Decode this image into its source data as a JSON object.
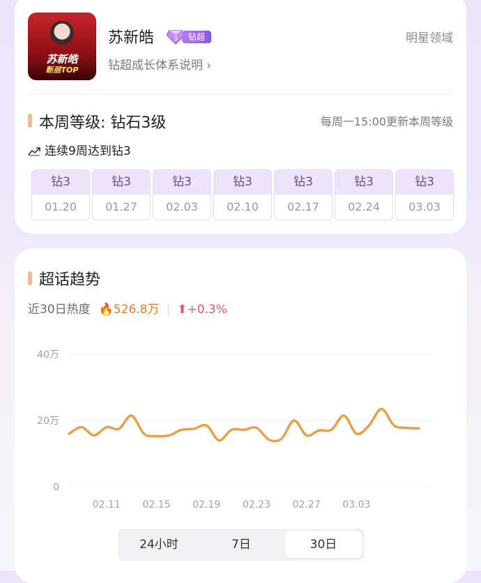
{
  "profile": {
    "avatar_text_1": "苏新皓",
    "avatar_text_2": "断层TOP",
    "name": "苏新皓",
    "badge_level": "3",
    "badge_label": "钻超",
    "growth_link": "钻超成长体系说明 ›",
    "region": "明星领域"
  },
  "level": {
    "title": "本周等级: 钻石3级",
    "update_note": "每周一15:00更新本周等级",
    "streak": "连续9周达到钻3",
    "weeks": [
      {
        "level": "钻3",
        "date": "01.20"
      },
      {
        "level": "钻3",
        "date": "01.27"
      },
      {
        "level": "钻3",
        "date": "02.03"
      },
      {
        "level": "钻3",
        "date": "02.10"
      },
      {
        "level": "钻3",
        "date": "02.17"
      },
      {
        "level": "钻3",
        "date": "02.24"
      },
      {
        "level": "钻3",
        "date": "03.03"
      }
    ]
  },
  "trend": {
    "title": "超话趋势",
    "heat_label": "近30日热度",
    "heat_value": "526.8万",
    "change": "+0.3%",
    "icons": {
      "fire": "fire-icon",
      "up": "arrow-up-icon"
    },
    "colors": {
      "line": "#e8a04a",
      "accent": "#f2b98a",
      "up": "#e8536b"
    }
  },
  "chart_data": {
    "type": "line",
    "y_ticks": [
      "0",
      "20万",
      "40万"
    ],
    "ylim": [
      0,
      400000
    ],
    "x_tick_labels": [
      "02.11",
      "02.15",
      "02.19",
      "02.23",
      "02.27",
      "03.03"
    ],
    "x_range": [
      "02.08",
      "03.09"
    ],
    "grid": true,
    "series": [
      {
        "values": [
          {
            "x": "02.08",
            "y": 160000
          },
          {
            "x": "02.09",
            "y": 180000
          },
          {
            "x": "02.10",
            "y": 155000
          },
          {
            "x": "02.11",
            "y": 180000
          },
          {
            "x": "02.12",
            "y": 175000
          },
          {
            "x": "02.13",
            "y": 215000
          },
          {
            "x": "02.14",
            "y": 160000
          },
          {
            "x": "02.15",
            "y": 153000
          },
          {
            "x": "02.16",
            "y": 155000
          },
          {
            "x": "02.17",
            "y": 172000
          },
          {
            "x": "02.18",
            "y": 175000
          },
          {
            "x": "02.19",
            "y": 185000
          },
          {
            "x": "02.20",
            "y": 140000
          },
          {
            "x": "02.21",
            "y": 172000
          },
          {
            "x": "02.22",
            "y": 172000
          },
          {
            "x": "02.23",
            "y": 178000
          },
          {
            "x": "02.24",
            "y": 142000
          },
          {
            "x": "02.25",
            "y": 145000
          },
          {
            "x": "02.26",
            "y": 200000
          },
          {
            "x": "02.27",
            "y": 155000
          },
          {
            "x": "02.28",
            "y": 170000
          },
          {
            "x": "03.01",
            "y": 172000
          },
          {
            "x": "03.02",
            "y": 215000
          },
          {
            "x": "03.03",
            "y": 160000
          },
          {
            "x": "03.04",
            "y": 185000
          },
          {
            "x": "03.05",
            "y": 235000
          },
          {
            "x": "03.06",
            "y": 185000
          },
          {
            "x": "03.07",
            "y": 178000
          },
          {
            "x": "03.08",
            "y": 176000
          }
        ]
      }
    ]
  },
  "range_tabs": {
    "options": [
      "24小时",
      "7日",
      "30日"
    ],
    "selected": "30日"
  }
}
